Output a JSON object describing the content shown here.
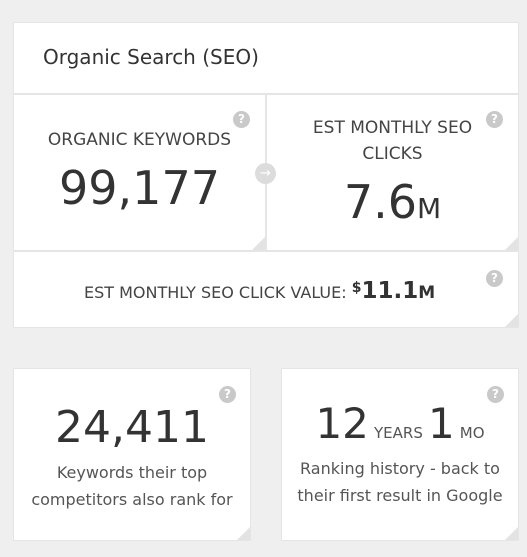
{
  "header": {
    "title": "Organic Search (SEO)"
  },
  "organic_keywords": {
    "label": "ORGANIC KEYWORDS",
    "value": "99,177"
  },
  "monthly_clicks": {
    "label": "EST MONTHLY SEO CLICKS",
    "value": "7.6",
    "unit": "M"
  },
  "click_value": {
    "label": "EST MONTHLY SEO CLICK VALUE:",
    "currency": "$",
    "value": "11.1",
    "unit": "M"
  },
  "competitor_keywords": {
    "value": "24,411",
    "description": "Keywords their top competitors also rank for"
  },
  "ranking_history": {
    "years": "12",
    "years_unit": "YEARS",
    "months": "1",
    "months_unit": "MO",
    "description": "Ranking history - back to their first result in Google"
  },
  "icons": {
    "help": "?",
    "arrow": "→"
  },
  "colors": {
    "background": "#efefef",
    "card": "#ffffff",
    "text": "#333333",
    "help_icon": "#c9c9c9"
  }
}
